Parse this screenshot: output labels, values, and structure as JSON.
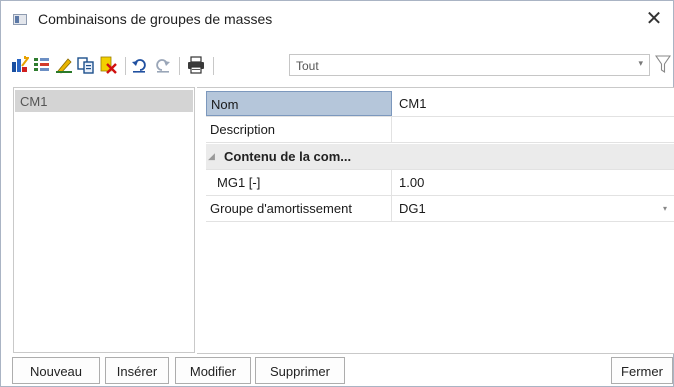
{
  "window": {
    "title": "Combinaisons de groupes de masses",
    "close_glyph": "✕"
  },
  "toolbar": {
    "icons": [
      "new-item-icon",
      "generate-icon",
      "edit-icon",
      "copy-icon",
      "delete-icon",
      "undo-icon",
      "redo-icon",
      "print-icon",
      "filter-icon"
    ],
    "filter_value": "Tout"
  },
  "list": {
    "items": [
      {
        "label": "CM1",
        "selected": true
      }
    ]
  },
  "properties": {
    "rows": [
      {
        "name": "Nom",
        "value": "CM1"
      },
      {
        "name": "Description",
        "value": ""
      },
      {
        "category": "Contenu de la com..."
      },
      {
        "name": "MG1 [-]",
        "value": "1.00"
      },
      {
        "name": "Groupe d'amortissement",
        "value": "DG1"
      }
    ]
  },
  "buttons": {
    "new": "Nouveau",
    "insert": "Insérer",
    "modify": "Modifier",
    "delete": "Supprimer",
    "close": "Fermer"
  },
  "colors": {
    "selection": "#b5c6da",
    "list_selection": "#d4d4d4",
    "category_bg": "#ebebeb"
  }
}
